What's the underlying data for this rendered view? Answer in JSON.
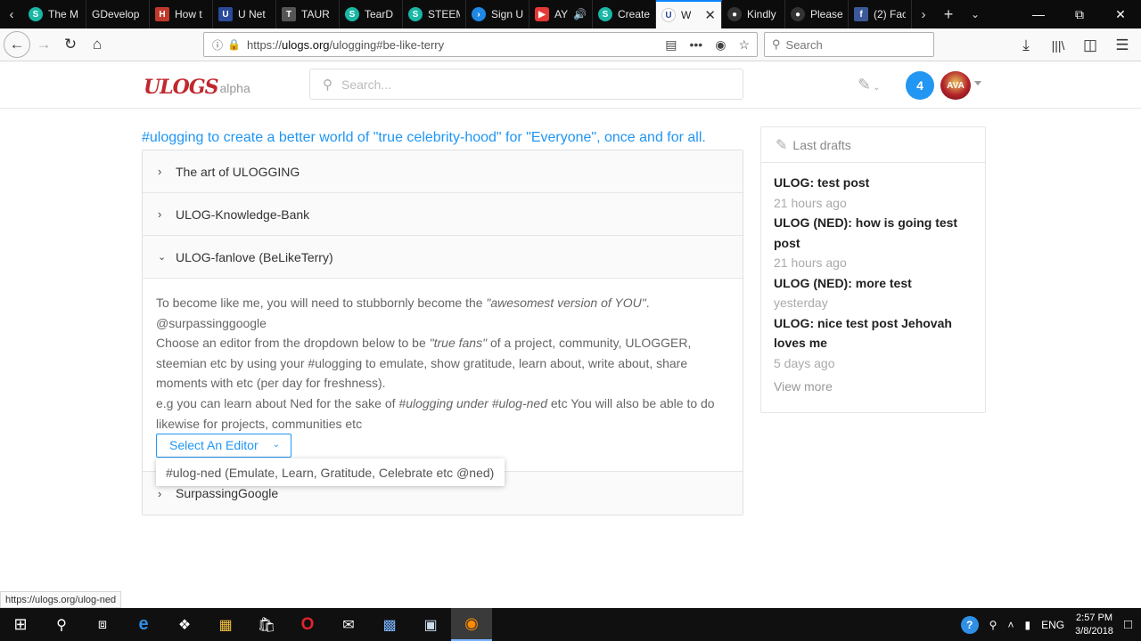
{
  "browser": {
    "tabs": [
      {
        "title": "The M",
        "icon": "steem-icon",
        "color": "#19b7a6"
      },
      {
        "title": "GDevelop",
        "icon": "gdevelop-icon",
        "color": "#5a3bd6"
      },
      {
        "title": "How t",
        "icon": "howto-icon",
        "color": "#c0392b"
      },
      {
        "title": "U Net",
        "icon": "unet-icon",
        "color": "#2a4b9b"
      },
      {
        "title": "TAUR",
        "icon": "taur-icon",
        "color": "#777"
      },
      {
        "title": "TearD",
        "icon": "steem-icon",
        "color": "#19b7a6"
      },
      {
        "title": "STEEM",
        "icon": "steem-icon",
        "color": "#19b7a6"
      },
      {
        "title": "Sign U",
        "icon": "signup-icon",
        "color": "#1e88e5"
      },
      {
        "title": "AY",
        "icon": "youtube-icon",
        "color": "#e53935"
      },
      {
        "title": "Create",
        "icon": "steem-icon",
        "color": "#19b7a6"
      },
      {
        "title": "W",
        "icon": "ulogs-icon",
        "color": "#2a4b9b"
      },
      {
        "title": "Kindly",
        "icon": "github-icon",
        "color": "#333"
      },
      {
        "title": "Please",
        "icon": "github-icon",
        "color": "#333"
      },
      {
        "title": "(2) Fac",
        "icon": "facebook-icon",
        "color": "#3b5998"
      }
    ],
    "url_prefix": "https://",
    "url_domain": "ulogs.org",
    "url_path": "/ulogging#be-like-terry",
    "search_placeholder": "Search",
    "status_url": "https://ulogs.org/ulog-ned"
  },
  "site": {
    "logo_text": "ULOGS",
    "alpha_label": "alpha",
    "search_placeholder": "Search...",
    "notification_count": "4",
    "avatar_label": "AVA"
  },
  "main": {
    "heading": "#ulogging to create a better world of \"true celebrity-hood\" for \"Everyone\", once and for all.",
    "sections": [
      {
        "title": "The art of ULOGGING",
        "expanded": false
      },
      {
        "title": "ULOG-Knowledge-Bank",
        "expanded": false
      },
      {
        "title": "ULOG-fanlove (BeLikeTerry)",
        "expanded": true
      },
      {
        "title": "SurpassingGoogle",
        "expanded": false
      }
    ],
    "body": {
      "l1_a": "To become like me, you will need to stubbornly become the ",
      "l1_em": "\"awesomest version of YOU\"",
      "l1_b": ".",
      "l2": "@surpassinggoogle",
      "l3_a": "Choose an editor from the dropdown below to be ",
      "l3_em": "\"true fans\"",
      "l3_b": " of a project, community, ULOGGER,",
      "l4": "steemian etc by using your #ulogging to emulate, show gratitude, learn about, write about, share",
      "l5": "moments with etc (per day for freshness).",
      "l6_a": "e.g you can learn about Ned for the sake of ",
      "l6_em": "#ulogging under #ulog-ned",
      "l6_b": " etc You will also be able to do",
      "l7": "likewise for projects, communities etc"
    },
    "editor_select_label": "Select An Editor",
    "dropdown_option": "#ulog-ned (Emulate, Learn, Gratitude, Celebrate etc @ned)"
  },
  "sidebar": {
    "title": "Last drafts",
    "drafts": [
      {
        "title": "ULOG: test post",
        "time": "21 hours ago"
      },
      {
        "title": "ULOG (NED): how is going test post",
        "time": "21 hours ago"
      },
      {
        "title": "ULOG (NED): more test",
        "time": "yesterday"
      },
      {
        "title": "ULOG: nice test post Jehovah loves me",
        "time": "5 days ago"
      }
    ],
    "view_more": "View more"
  },
  "taskbar": {
    "language": "ENG",
    "time": "2:57 PM",
    "date": "3/8/2018"
  }
}
